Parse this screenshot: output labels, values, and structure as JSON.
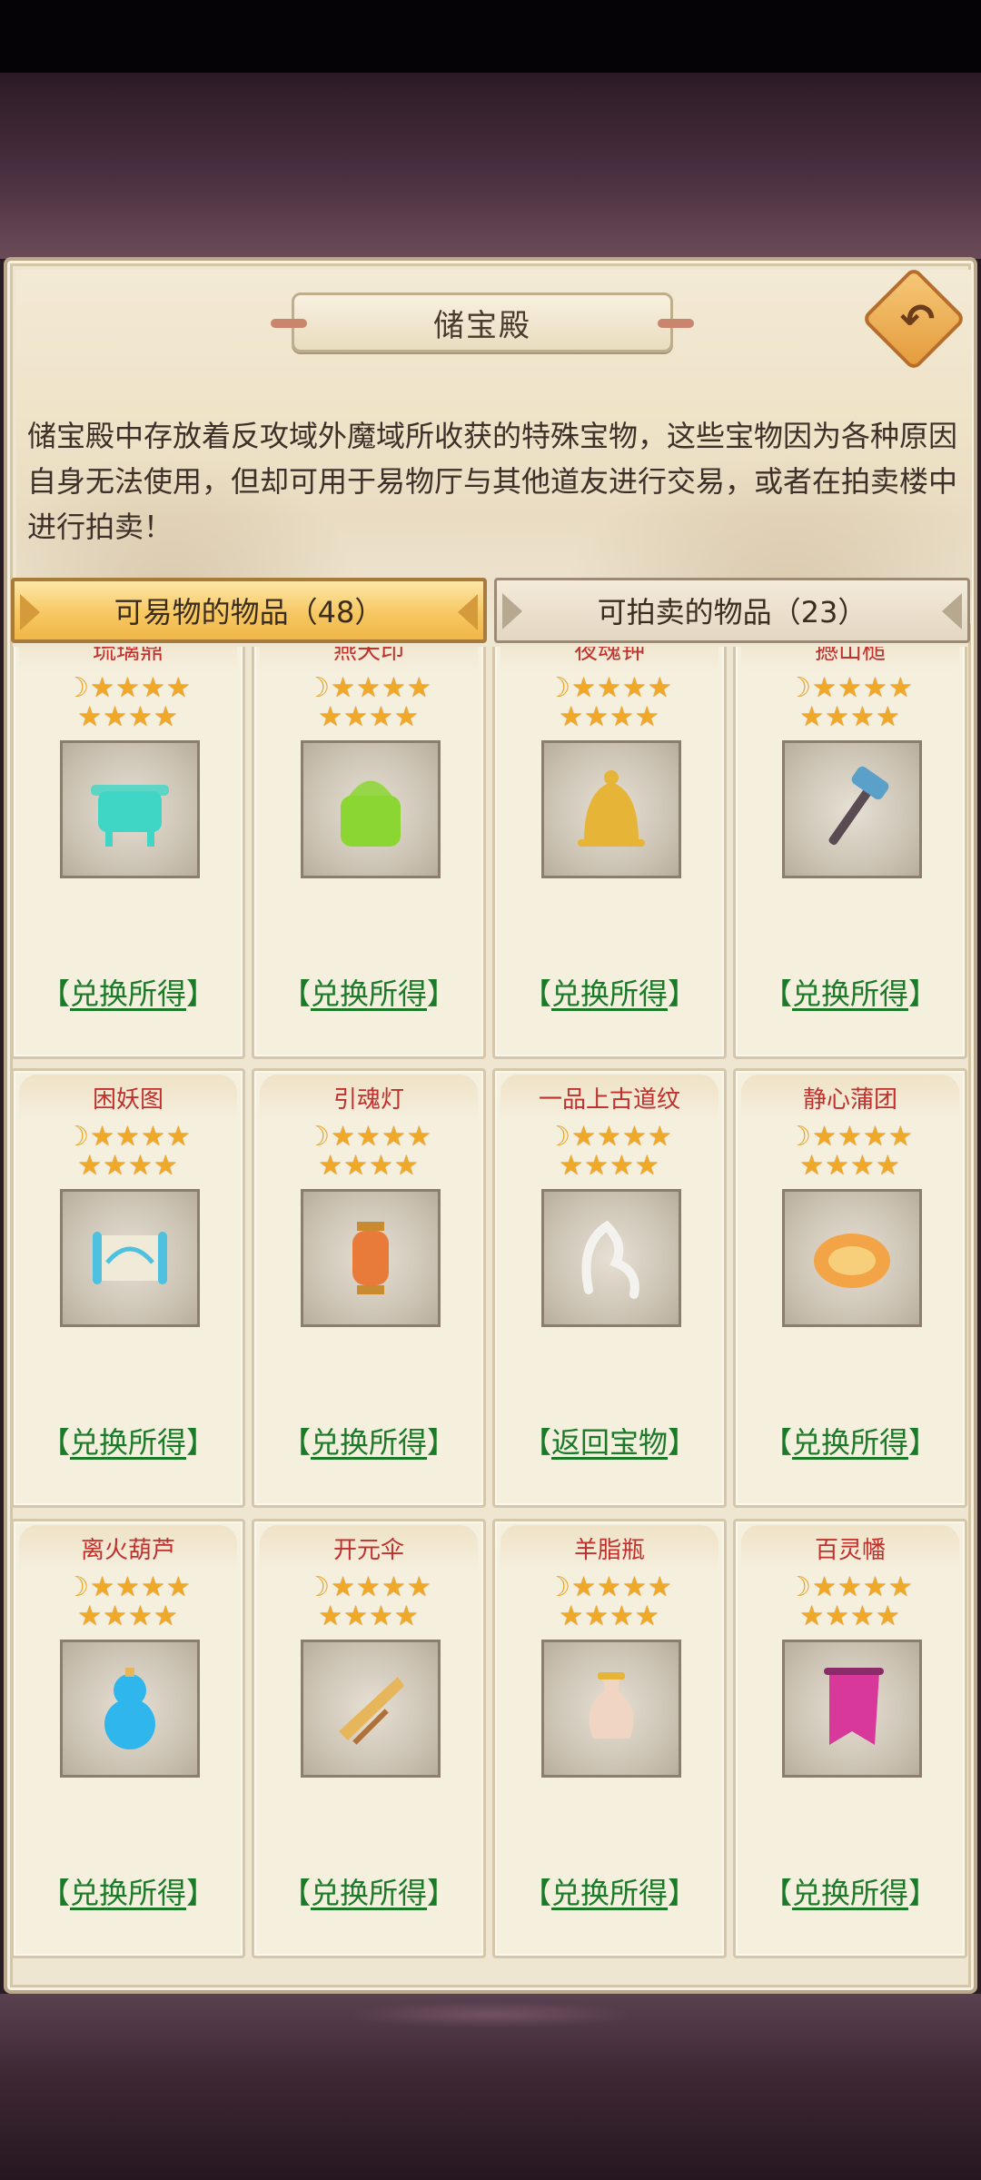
{
  "panel": {
    "title": "储宝殿",
    "description": "储宝殿中存放着反攻域外魔域所收获的特殊宝物，这些宝物因为各种原因自身无法使用，但却可用于易物厅与其他道友进行交易，或者在拍卖楼中进行拍卖！"
  },
  "tabs": [
    {
      "label": "可易物的物品（48）",
      "active": true
    },
    {
      "label": "可拍卖的物品（23）",
      "active": false
    }
  ],
  "stars": {
    "moon": "☽",
    "star": "★",
    "row1_stars": 4,
    "row2_stars": 4
  },
  "brackets": {
    "left": "【",
    "right": "】"
  },
  "items": [
    {
      "name": "琉璃鼎",
      "action": "兑换所得",
      "icon": "cauldron-icon",
      "color": "#3fd6c6"
    },
    {
      "name": "燕天印",
      "action": "兑换所得",
      "icon": "seal-icon",
      "color": "#8bd632"
    },
    {
      "name": "夜魂钟",
      "action": "兑换所得",
      "icon": "bell-icon",
      "color": "#e6b437"
    },
    {
      "name": "撼山槌",
      "action": "兑换所得",
      "icon": "hammer-icon",
      "color": "#5aa0c8"
    },
    {
      "name": "困妖图",
      "action": "兑换所得",
      "icon": "scroll-icon",
      "color": "#4ec0e0"
    },
    {
      "name": "引魂灯",
      "action": "兑换所得",
      "icon": "lantern-icon",
      "color": "#e87a3a"
    },
    {
      "name": "一品上古道纹",
      "action": "返回宝物",
      "icon": "rune-icon",
      "color": "#f4f2ee"
    },
    {
      "name": "静心蒲团",
      "action": "兑换所得",
      "icon": "cushion-icon",
      "color": "#f2a446"
    },
    {
      "name": "离火葫芦",
      "action": "兑换所得",
      "icon": "gourd-icon",
      "color": "#2fb6ec"
    },
    {
      "name": "开元伞",
      "action": "兑换所得",
      "icon": "umbrella-icon",
      "color": "#e8b65a"
    },
    {
      "name": "羊脂瓶",
      "action": "兑换所得",
      "icon": "vase-icon",
      "color": "#f0d6c2"
    },
    {
      "name": "百灵幡",
      "action": "兑换所得",
      "icon": "banner-icon",
      "color": "#d8389a"
    }
  ]
}
